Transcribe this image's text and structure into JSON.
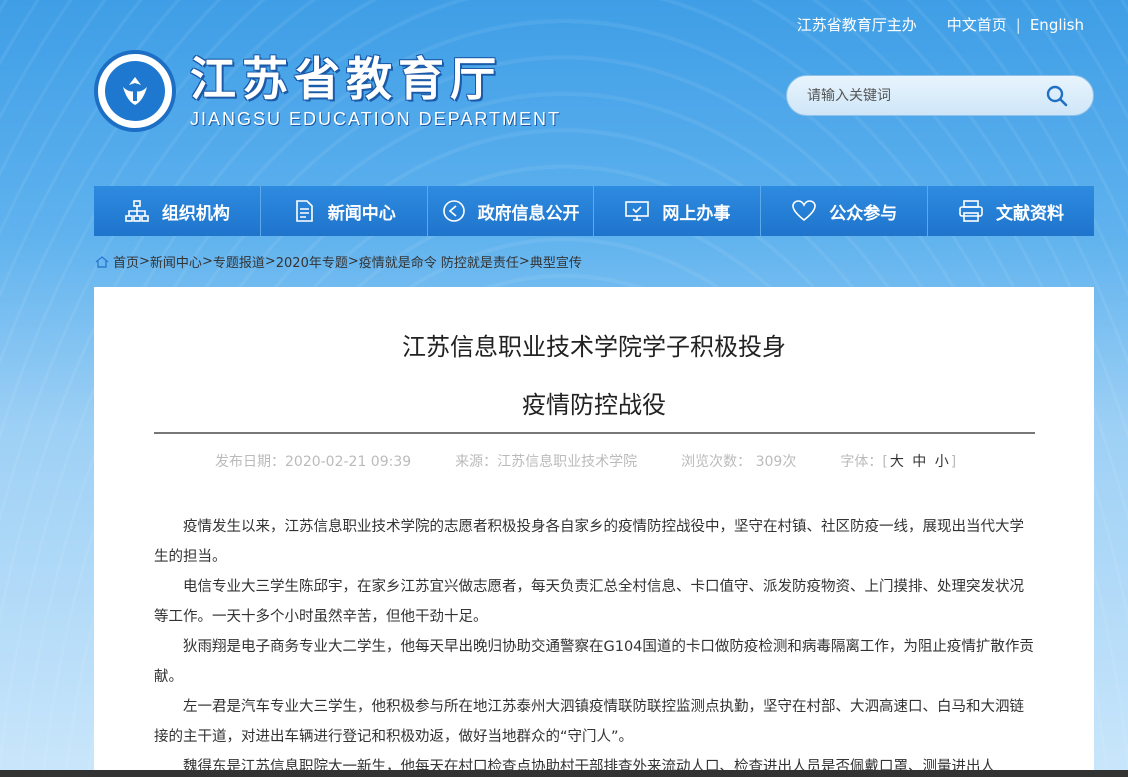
{
  "header": {
    "sponsor": "江苏省教育厅主办",
    "lang_cn": "中文首页",
    "lang_sep": "|",
    "lang_en": "English",
    "logo_cn": "江苏省教育厅",
    "logo_en": "JIANGSU EDUCATION DEPARTMENT"
  },
  "search": {
    "placeholder": "请输入关键词",
    "icon": "search-icon"
  },
  "nav": [
    {
      "label": "组织机构",
      "icon": "org-chart-icon"
    },
    {
      "label": "新闻中心",
      "icon": "document-icon"
    },
    {
      "label": "政府信息公开",
      "icon": "megaphone-icon"
    },
    {
      "label": "网上办事",
      "icon": "monitor-icon"
    },
    {
      "label": "公众参与",
      "icon": "heart-icon"
    },
    {
      "label": "文献资料",
      "icon": "printer-icon"
    }
  ],
  "breadcrumb": {
    "items": [
      "首页",
      "新闻中心",
      "专题报道",
      "2020年专题",
      "疫情就是命令 防控就是责任",
      "典型宣传"
    ],
    "sep": ">"
  },
  "article": {
    "title_line1": "江苏信息职业技术学院学子积极投身",
    "title_line2": "疫情防控战役",
    "date": "发布日期：2020-02-21 09:39",
    "source": "来源：江苏信息职业技术学院",
    "views": "浏览次数：  309次",
    "font_label": "字体：",
    "font_open": "[",
    "font_large": "大",
    "font_medium": "中",
    "font_small": "小",
    "font_close": "]",
    "paragraphs": [
      "疫情发生以来，江苏信息职业技术学院的志愿者积极投身各自家乡的疫情防控战役中，坚守在村镇、社区防疫一线，展现出当代大学生的担当。",
      "电信专业大三学生陈邱宇，在家乡江苏宜兴做志愿者，每天负责汇总全村信息、卡口值守、派发防疫物资、上门摸排、处理突发状况等工作。一天十多个小时虽然辛苦，但他干劲十足。",
      "狄雨翔是电子商务专业大二学生，他每天早出晚归协助交通警察在G104国道的卡口做防疫检测和病毒隔离工作，为阻止疫情扩散作贡献。",
      "左一君是汽车专业大三学生，他积极参与所在地江苏泰州大泗镇疫情联防联控监测点执勤，坚守在村部、大泗高速口、白马和大泗链接的主干道，对进出车辆进行登记和积极劝返，做好当地群众的“守门人”。",
      "魏得东是江苏信息职院大一新生，他每天在村口检查点协助村干部排查外来流动人口、检查进出人员是否佩戴口罩、测量进出人"
    ]
  }
}
